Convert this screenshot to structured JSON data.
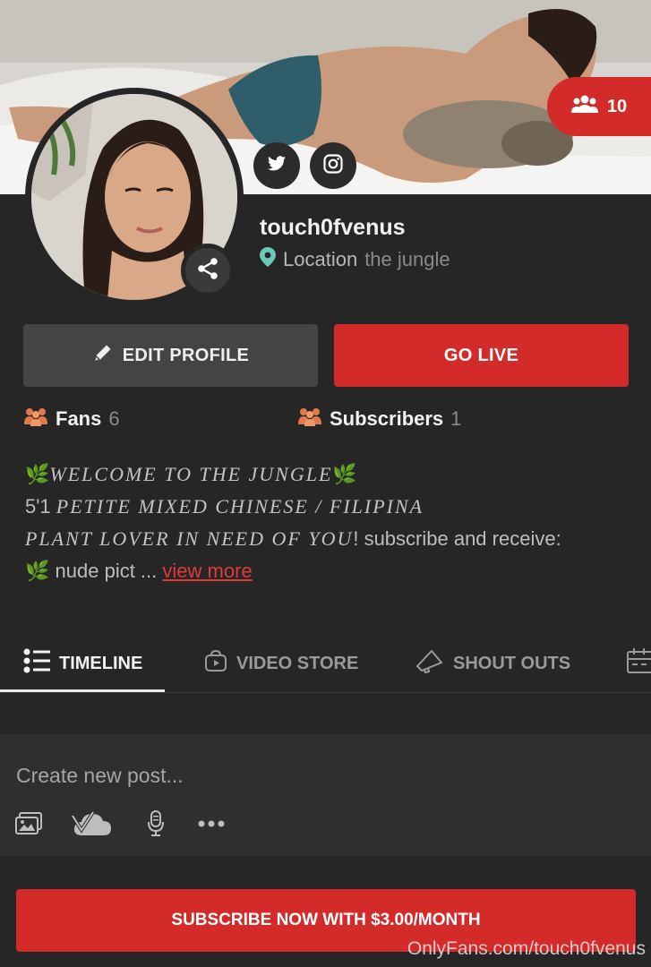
{
  "header": {
    "online_count": "10"
  },
  "profile": {
    "username": "touch0fvenus",
    "location_label": "Location",
    "location_value": "the jungle"
  },
  "actions": {
    "edit_label": "EDIT PROFILE",
    "live_label": "GO LIVE"
  },
  "stats": {
    "fans_label": "Fans",
    "fans_count": "6",
    "subscribers_label": "Subscribers",
    "subscribers_count": "1"
  },
  "bio": {
    "line1": "WELCOME TO THE JUNGLE",
    "line2_plain": "5'1",
    "line2_fancy": "PETITE MIXED CHINESE / FILIPINA",
    "line3_fancy": "PLANT LOVER IN NEED OF YOU",
    "line3_plain": "! subscribe and receive:",
    "line4": "nude pict ...",
    "view_more": "view more"
  },
  "tabs": [
    {
      "label": "TIMELINE",
      "active": true
    },
    {
      "label": "VIDEO STORE",
      "active": false
    },
    {
      "label": "SHOUT OUTS",
      "active": false
    }
  ],
  "composer": {
    "placeholder": "Create new post..."
  },
  "subscribe_label": "SUBSCRIBE NOW WITH $3.00/MONTH",
  "watermark": "OnlyFans.com/touch0fvenus",
  "colors": {
    "accent": "#d32a2a",
    "background": "#262626",
    "panel": "#2f2f2f",
    "icon_orange": "#e07a4a",
    "location_pin": "#6fc7b8"
  }
}
